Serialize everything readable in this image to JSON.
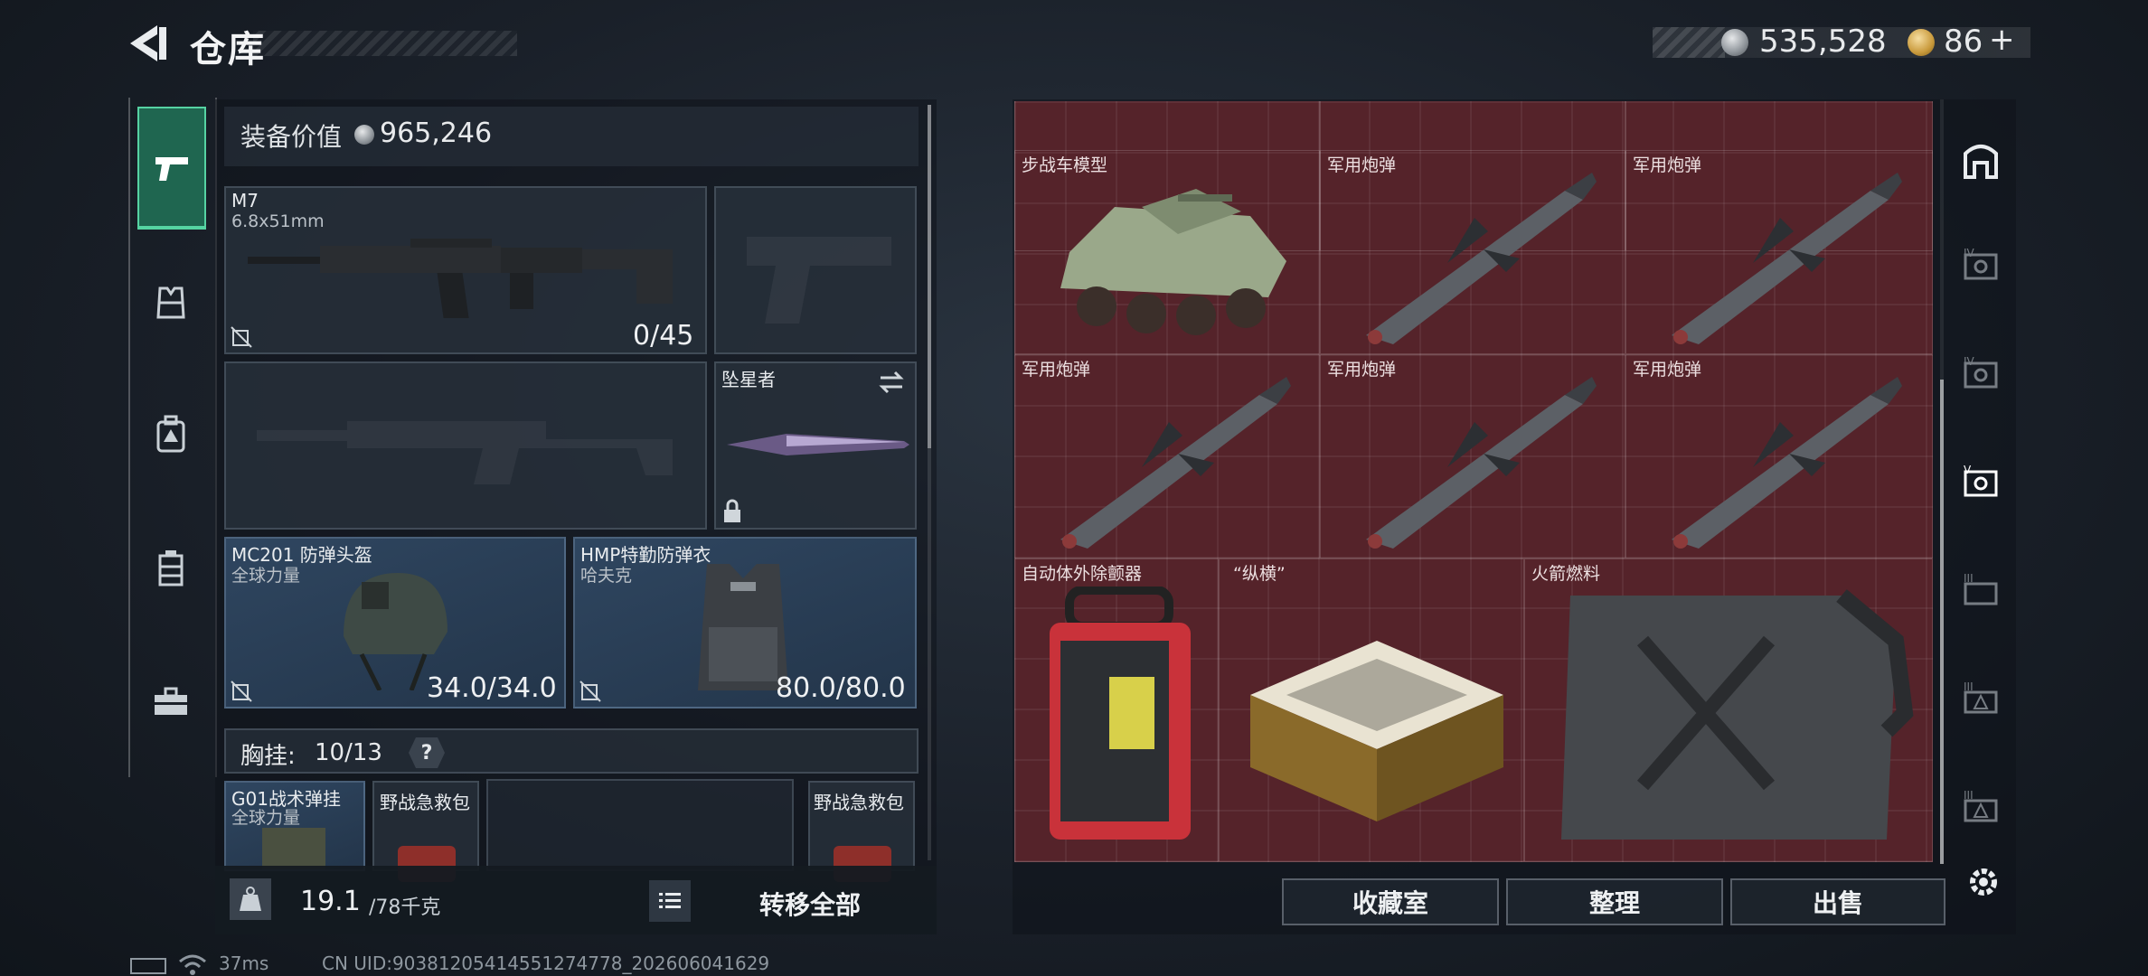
{
  "header": {
    "title": "仓库",
    "currency_silver": "535,528",
    "currency_gold": "86",
    "currency_plus": "+"
  },
  "left_rail": {
    "tabs": [
      {
        "icon": "pistol-icon",
        "active": true
      },
      {
        "icon": "vest-icon",
        "active": false
      },
      {
        "icon": "backpack-icon",
        "active": false
      },
      {
        "icon": "chest-rig-icon",
        "active": false
      },
      {
        "icon": "briefcase-icon",
        "active": false
      }
    ]
  },
  "loadout": {
    "value_label": "装备价值",
    "value": "965,246",
    "primary": {
      "name": "M7",
      "ammo_type": "6.8x51mm",
      "ammo_count": "0/45"
    },
    "secondary_name": "",
    "melee": {
      "name": "坠星者"
    },
    "helmet": {
      "name": "MC201 防弹头盔",
      "brand": "全球力量",
      "durability": "34.0/34.0"
    },
    "armor": {
      "name": "HMP特勤防弹衣",
      "brand": "哈夫克",
      "durability": "80.0/80.0"
    },
    "chest_rig_label": "胸挂:",
    "chest_rig_capacity": "10/13",
    "help": "?",
    "rig_items": [
      {
        "name": "G01战术弹挂",
        "brand": "全球力量"
      },
      {
        "name": "野战急救包"
      },
      {
        "name": "野战急救包"
      }
    ],
    "weight": "19.1",
    "weight_max": "/78千克",
    "transfer_all": "转移全部"
  },
  "storage": {
    "items": [
      {
        "name": "步战车模型"
      },
      {
        "name": "军用炮弹"
      },
      {
        "name": "军用炮弹"
      },
      {
        "name": "军用炮弹"
      },
      {
        "name": "军用炮弹"
      },
      {
        "name": "军用炮弹"
      },
      {
        "name": "自动体外除颤器"
      },
      {
        "name": "“纵横”"
      },
      {
        "name": "火箭燃料"
      }
    ],
    "buttons": {
      "collection": "收藏室",
      "sort": "整理",
      "sell": "出售"
    }
  },
  "status": {
    "ping": "37ms",
    "uid": "CN UID:9038120541455127477​8_202606041629"
  },
  "colors": {
    "accent": "#56d3a3",
    "storage_bg": "#55232a"
  }
}
